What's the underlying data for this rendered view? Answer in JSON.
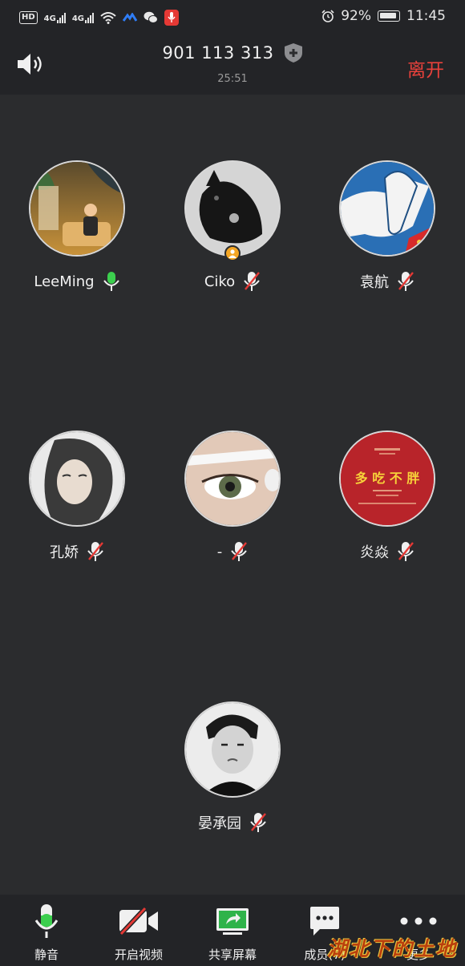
{
  "status_bar": {
    "hd": "HD",
    "signal1": "4G",
    "signal2": "4G",
    "battery": "92%",
    "time": "11:45"
  },
  "header": {
    "meeting_id": "901 113 313",
    "timer": "25:51",
    "leave_label": "离开",
    "speaker_icon": "speaker-icon",
    "shield_icon": "shield-plus-icon"
  },
  "participants": [
    {
      "name": "LeeMing",
      "mic": "on",
      "host": false
    },
    {
      "name": "Ciko",
      "mic": "muted",
      "host": true
    },
    {
      "name": "袁航",
      "mic": "muted",
      "host": false
    },
    {
      "name": "孔娇",
      "mic": "muted",
      "host": false
    },
    {
      "name": "-",
      "mic": "muted",
      "host": false
    },
    {
      "name": "炎焱",
      "mic": "muted",
      "host": false
    },
    {
      "name": "晏承园",
      "mic": "muted",
      "host": false
    }
  ],
  "avatar_texts": {
    "food": "多 吃 不 胖"
  },
  "toolbar": {
    "mute": "静音",
    "video": "开启视频",
    "share": "共享屏幕",
    "members": "成员(7)",
    "more": "更多"
  },
  "watermark": "湖北下的土地",
  "colors": {
    "leave": "#e8413b",
    "mic_on": "#3ccf4e",
    "mic_muted_slash": "#e53935",
    "host_badge": "#f5a623",
    "share_green": "#2fb34a"
  }
}
